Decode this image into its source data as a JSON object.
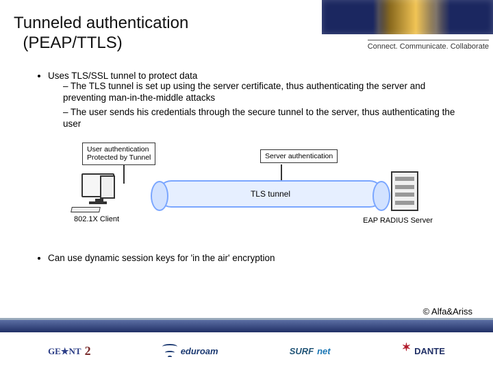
{
  "header": {
    "title_line1": "Tunneled authentication",
    "title_line2": "(PEAP/TTLS)",
    "tagline": "Connect. Communicate. Collaborate"
  },
  "bullets": {
    "b1": "Uses TLS/SSL tunnel to protect data",
    "b1a": "The TLS tunnel is set up using the server certificate, thus authenticating the server and preventing man-in-the-middle attacks",
    "b1b": "The user sends his credentials through the secure tunnel to the server, thus authenticating the user",
    "b2": "Can use dynamic session keys for 'in the air' encryption"
  },
  "diagram": {
    "user_auth_box_l1": "User authentication",
    "user_auth_box_l2": "Protected by Tunnel",
    "server_auth_box": "Server authentication",
    "tunnel_label": "TLS tunnel",
    "client_label": "802.1X Client",
    "server_label": "EAP RADIUS Server"
  },
  "copyright": "© Alfa&Ariss",
  "logos": {
    "geant": "GE★NT",
    "geant2": "2",
    "eduroam": "eduroam",
    "surfnet_a": "SURF",
    "surfnet_b": "net",
    "dante": "DANTE"
  }
}
